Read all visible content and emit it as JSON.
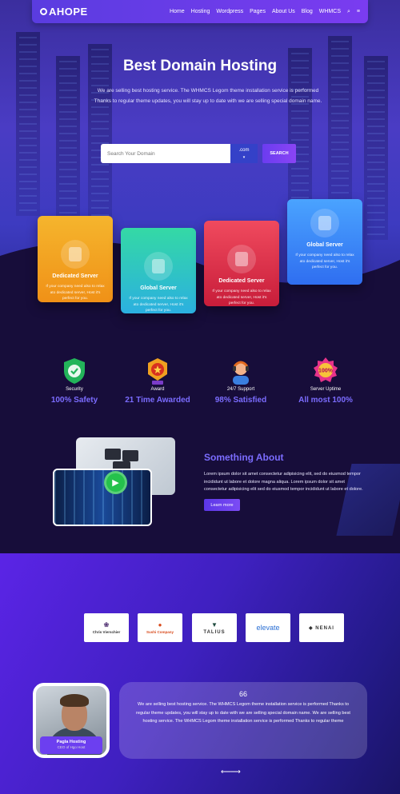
{
  "nav": {
    "logo": "AHOPE",
    "items": [
      "Home",
      "Hosting",
      "Wordpress",
      "Pages",
      "About Us",
      "Blog",
      "WHMCS"
    ]
  },
  "hero": {
    "title": "Best Domain Hosting",
    "text": "We are selling best hosting service. The WHMCS Legom theme installation service is performed Thanks to regular theme updates, you will stay up to date with we are selling special domain name.",
    "search_placeholder": "Search Your Domain",
    "tld": ".com",
    "search_button": "SEARCH"
  },
  "cards": [
    {
      "title": "Dedicated Server",
      "text": "If your company need also to relax ato dedicated server, Host it's perfect for you.",
      "icon": "database-icon"
    },
    {
      "title": "Global Server",
      "text": "If your company need also to relax ato dedicated server, Host it's perfect for you.",
      "icon": "shield-check-icon"
    },
    {
      "title": "Dedicated Server",
      "text": "If your company need also to relax ato dedicated server, Host it's perfect for you.",
      "icon": "cloud-server-icon"
    },
    {
      "title": "Global Server",
      "text": "If your company need also to relax ato dedicated server, Host it's perfect for you.",
      "icon": "wordpress-icon"
    }
  ],
  "stats": [
    {
      "label": "Security",
      "value": "100% Safety",
      "icon": "shield-check-icon"
    },
    {
      "label": "Award",
      "value": "21 Time Awarded",
      "icon": "award-medal-icon"
    },
    {
      "label": "24/7 Support",
      "value": "98% Satisfied",
      "icon": "support-agent-icon"
    },
    {
      "label": "Server Uptime",
      "value": "All most 100%",
      "icon": "uptime-badge-icon"
    }
  ],
  "uptime_badge": "100%",
  "about": {
    "title": "Something About",
    "text": "Lorem ipsum dolor sit amet consectetur adipisicing elit, sed do eiusmod tempor incididunt ut labore et dolore magna aliqua. Lorem ipsum dolor sit amet consectetur adipisicing elit sed do eiusmod tempor incididunt ut labore et dolore.",
    "button": "Learn more"
  },
  "partners": [
    {
      "name": "Chris Vierschier",
      "mark": "❀",
      "color": "#5a3c7a"
    },
    {
      "name": "Sushi Company",
      "mark": "●",
      "color": "#d84a1b"
    },
    {
      "name": "TALIUS",
      "mark": "▼",
      "color": "#1e4a3e"
    },
    {
      "name": "elevate",
      "mark": "elevate",
      "color": "#2a6fd4"
    },
    {
      "name": "NENAI",
      "mark": "◆ NENAI",
      "color": "#333"
    }
  ],
  "testimonial": {
    "quote_mark": "66",
    "text": "We are selling best hosting service. The WHMCS Legom theme installation service is performed Thanks to regular theme updates, you will stay up to date with we are selling special domain name. We are selling best hosting service. The WHMCS Legom theme installation service is performed Thanks to regular theme",
    "name": "Pagla Hosting",
    "role": "CEO of Hgo Host",
    "arrows": "⟵⟶"
  }
}
